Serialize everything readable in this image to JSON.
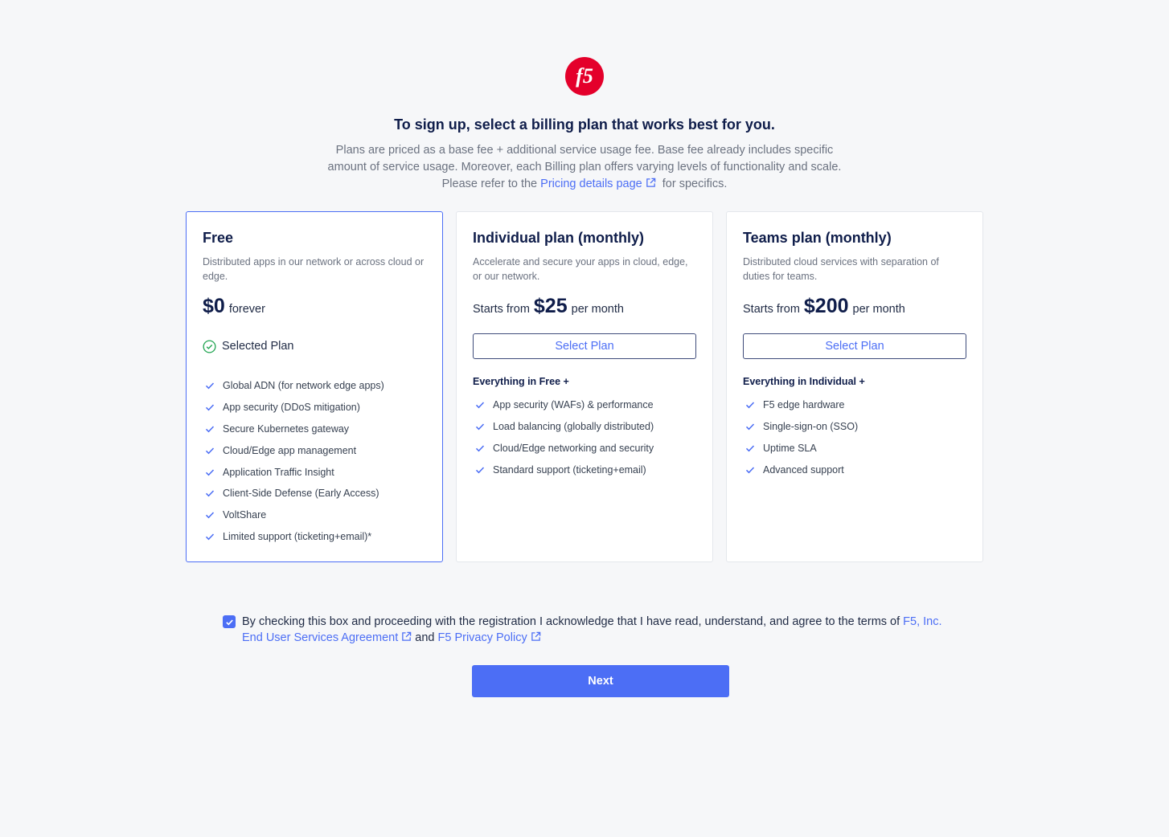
{
  "brand": {
    "logo_text": "f5",
    "logo_color": "#e4002b"
  },
  "header": {
    "title": "To sign up, select a billing plan that works best for you.",
    "intro_line1": "Plans are priced as a base fee + additional service usage fee. Base fee already includes specific",
    "intro_line2": "amount of service usage. Moreover, each Billing plan offers varying levels of functionality and scale.",
    "intro_line3_prefix": "Please refer to the",
    "pricing_link": "Pricing details page",
    "intro_line3_suffix": "for specifics."
  },
  "plans": [
    {
      "name": "Free",
      "description": "Distributed apps in our network or across cloud or edge.",
      "price": "$0",
      "price_suffix": "forever",
      "selected_label": "Selected Plan",
      "features": [
        "Global ADN (for network edge apps)",
        "App security (DDoS mitigation)",
        "Secure Kubernetes gateway",
        "Cloud/Edge app management",
        "Application Traffic Insight",
        "Client-Side Defense (Early Access)",
        "VoltShare",
        "Limited support (ticketing+email)*"
      ]
    },
    {
      "name": "Individual plan (monthly)",
      "description": "Accelerate and secure your apps in cloud, edge, or our network.",
      "price_prefix": "Starts from",
      "price": "$25",
      "price_suffix": "per month",
      "button_label": "Select Plan",
      "features_heading": "Everything in Free +",
      "features": [
        "App security (WAFs) & performance",
        "Load balancing (globally distributed)",
        "Cloud/Edge networking and security",
        "Standard support (ticketing+email)"
      ]
    },
    {
      "name": "Teams plan (monthly)",
      "description": "Distributed cloud services with separation of duties for teams.",
      "price_prefix": "Starts from",
      "price": "$200",
      "price_suffix": "per month",
      "button_label": "Select Plan",
      "features_heading": "Everything in Individual +",
      "features": [
        "F5 edge hardware",
        "Single-sign-on (SSO)",
        "Uptime SLA",
        "Advanced support"
      ]
    }
  ],
  "terms": {
    "checked": true,
    "text_prefix": "By checking this box and proceeding with the registration I acknowledge that I have read, understand, and agree to the terms of",
    "eula_link": "F5, Inc. End User Services Agreement",
    "and": "and",
    "privacy_link": "F5 Privacy Policy"
  },
  "next_button": "Next",
  "colors": {
    "accent": "#4c6ef5",
    "success": "#22a552",
    "heading": "#0f1d4a"
  }
}
